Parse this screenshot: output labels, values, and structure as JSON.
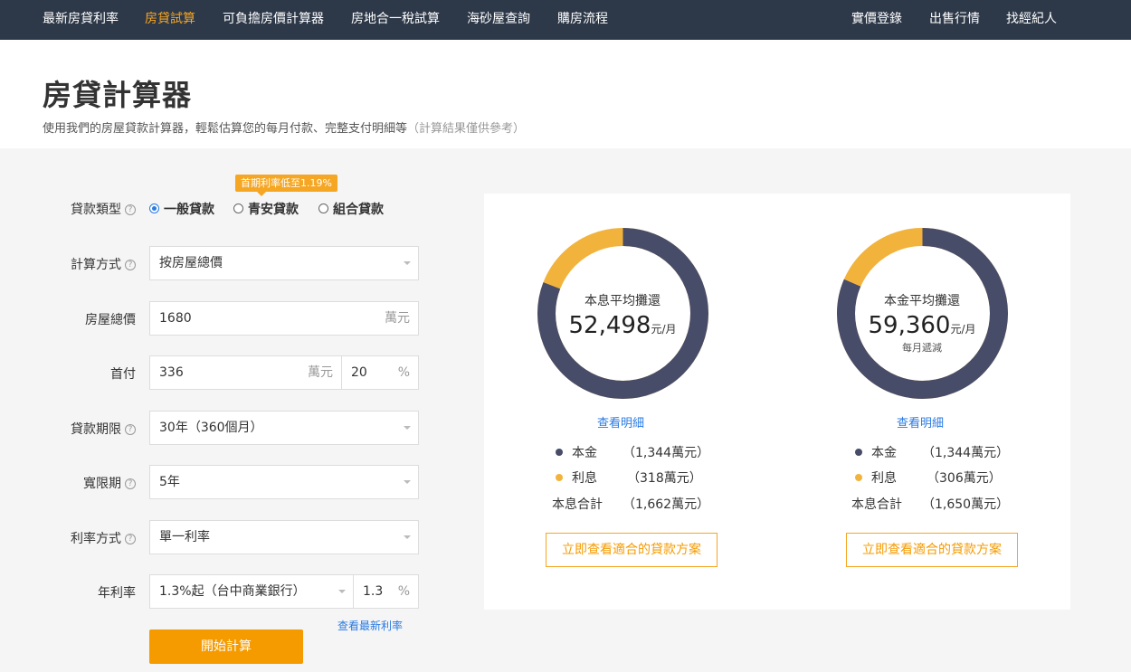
{
  "nav": {
    "left": [
      "最新房貸利率",
      "房貸試算",
      "可負擔房價計算器",
      "房地合一稅試算",
      "海砂屋查詢",
      "購房流程"
    ],
    "right": [
      "實價登錄",
      "出售行情",
      "找經紀人"
    ],
    "active": "房貸試算"
  },
  "header": {
    "title": "房貸計算器",
    "subtitle": "使用我們的房屋貸款計算器，輕鬆估算您的每月付款、完整支付明細等",
    "note": "（計算結果僅供參考）"
  },
  "form": {
    "loan_type": {
      "label": "貸款類型",
      "options": [
        "一般貸款",
        "青安貸款",
        "組合貸款"
      ],
      "selected": "一般貸款",
      "promo": "首期利率低至1.19%"
    },
    "calc_method": {
      "label": "計算方式",
      "value": "按房屋總價"
    },
    "house_price": {
      "label": "房屋總價",
      "value": "1680",
      "unit": "萬元"
    },
    "down_payment": {
      "label": "首付",
      "value": "336",
      "unit": "萬元",
      "percent": "20",
      "percent_unit": "%"
    },
    "loan_term": {
      "label": "貸款期限",
      "value": "30年（360個月）"
    },
    "grace_period": {
      "label": "寬限期",
      "value": "5年"
    },
    "rate_method": {
      "label": "利率方式",
      "value": "單一利率"
    },
    "annual_rate": {
      "label": "年利率",
      "bank": "1.3%起（台中商業銀行）",
      "value": "1.3",
      "unit": "%",
      "latest_link": "查看最新利率"
    },
    "submit": "開始計算"
  },
  "results": {
    "equal_payment": {
      "title": "本息平均攤還",
      "amount": "52,498",
      "unit": "元/月",
      "principal_fraction": 0.809,
      "detail_link": "查看明細",
      "principal_label": "本金",
      "principal": "（1,344萬元）",
      "interest_label": "利息",
      "interest": "（318萬元）",
      "total_label": "本息合計",
      "total": "（1,662萬元）",
      "cta": "立即查看適合的貸款方案"
    },
    "equal_principal": {
      "title": "本金平均攤還",
      "amount": "59,360",
      "unit": "元/月",
      "note": "每月遞減",
      "principal_fraction": 0.815,
      "detail_link": "查看明細",
      "principal_label": "本金",
      "principal": "（1,344萬元）",
      "interest_label": "利息",
      "interest": "（306萬元）",
      "total_label": "本息合計",
      "total": "（1,650萬元）",
      "cta": "立即查看適合的貸款方案"
    },
    "colors": {
      "principal": "#474c68",
      "interest": "#f2b33d"
    }
  }
}
